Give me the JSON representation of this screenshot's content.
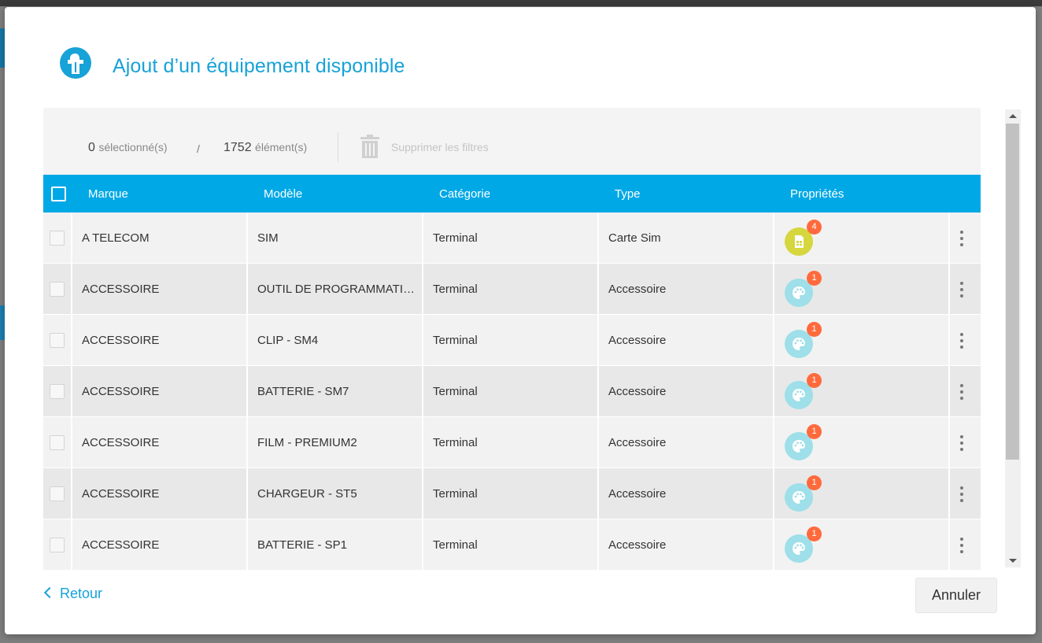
{
  "dialog": {
    "title": "Ajout d’un équipement disponible"
  },
  "toolbar": {
    "selected_count": "0",
    "selected_label": "sélectionné(s)",
    "separator": "/",
    "total_count": "1752",
    "total_label": "élément(s)",
    "clear_filters_label": "Supprimer les filtres"
  },
  "table": {
    "columns": [
      "Marque",
      "Modèle",
      "Catégorie",
      "Type",
      "Propriétés"
    ],
    "rows": [
      {
        "brand": "A TELECOM",
        "model": "SIM",
        "category": "Terminal",
        "type": "Carte Sim",
        "prop_icon": "sim-card-icon",
        "prop_count": "4"
      },
      {
        "brand": "ACCESSOIRE",
        "model": "OUTIL DE PROGRAMMATI…",
        "category": "Terminal",
        "type": "Accessoire",
        "prop_icon": "palette-icon",
        "prop_count": "1"
      },
      {
        "brand": "ACCESSOIRE",
        "model": "CLIP - SM4",
        "category": "Terminal",
        "type": "Accessoire",
        "prop_icon": "palette-icon",
        "prop_count": "1"
      },
      {
        "brand": "ACCESSOIRE",
        "model": "BATTERIE - SM7",
        "category": "Terminal",
        "type": "Accessoire",
        "prop_icon": "palette-icon",
        "prop_count": "1"
      },
      {
        "brand": "ACCESSOIRE",
        "model": "FILM - PREMIUM2",
        "category": "Terminal",
        "type": "Accessoire",
        "prop_icon": "palette-icon",
        "prop_count": "1"
      },
      {
        "brand": "ACCESSOIRE",
        "model": "CHARGEUR - ST5",
        "category": "Terminal",
        "type": "Accessoire",
        "prop_icon": "palette-icon",
        "prop_count": "1"
      },
      {
        "brand": "ACCESSOIRE",
        "model": "BATTERIE - SP1",
        "category": "Terminal",
        "type": "Accessoire",
        "prop_icon": "palette-icon",
        "prop_count": "1"
      }
    ]
  },
  "footer": {
    "back_label": "Retour",
    "cancel_label": "Annuler"
  },
  "colors": {
    "accent": "#17a2d8",
    "header_bg": "#00a8e6",
    "badge": "#ff6a3d",
    "sim_icon_bg": "#d6d63f",
    "accessory_icon_bg": "#9edfe9"
  }
}
